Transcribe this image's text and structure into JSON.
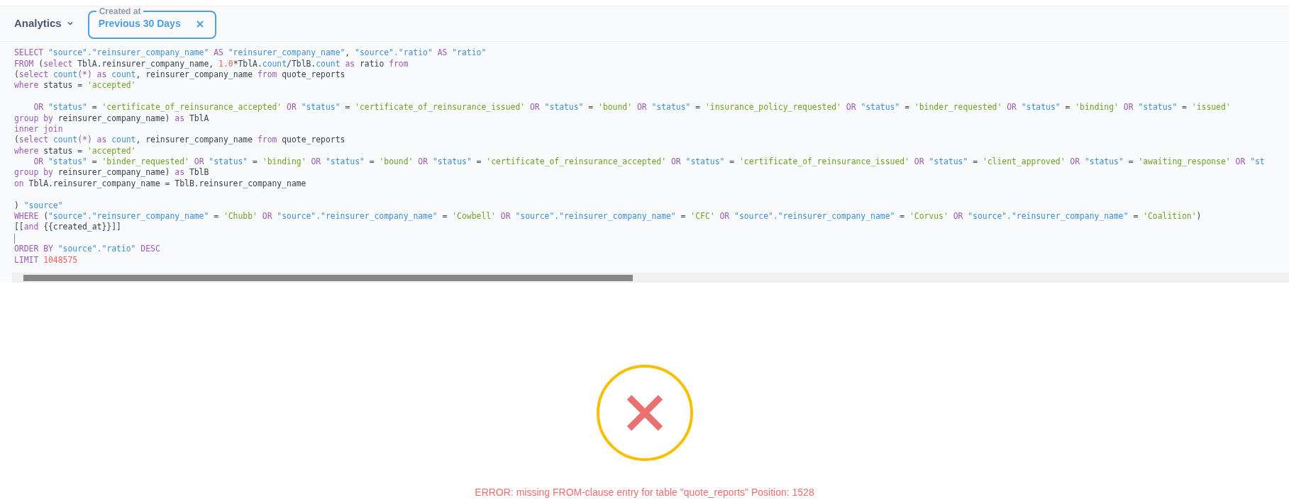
{
  "header": {
    "title": "Analytics",
    "filter": {
      "label": "Created at",
      "value": "Previous 30 Days"
    }
  },
  "editor": {
    "lines": [
      {
        "kind": "code",
        "tokens": [
          {
            "kind": "k",
            "text": "SELECT "
          },
          {
            "kind": "i",
            "text": "\"source\".\"reinsurer_company_name\""
          },
          {
            "kind": "k",
            "text": " AS "
          },
          {
            "kind": "i",
            "text": "\"reinsurer_company_name\""
          },
          {
            "kind": "p",
            "text": ", "
          },
          {
            "kind": "i",
            "text": "\"source\".\"ratio\""
          },
          {
            "kind": "k",
            "text": " AS "
          },
          {
            "kind": "i",
            "text": "\"ratio\""
          }
        ]
      },
      {
        "kind": "code",
        "tokens": [
          {
            "kind": "k",
            "text": "FROM"
          },
          {
            "kind": "p",
            "text": " ("
          },
          {
            "kind": "k",
            "text": "select"
          },
          {
            "kind": "p",
            "text": " TblA.reinsurer_company_name, "
          },
          {
            "kind": "n",
            "text": "1.0"
          },
          {
            "kind": "p",
            "text": "*TblA."
          },
          {
            "kind": "i",
            "text": "count"
          },
          {
            "kind": "p",
            "text": "/TblB."
          },
          {
            "kind": "i",
            "text": "count"
          },
          {
            "kind": "k",
            "text": " as"
          },
          {
            "kind": "p",
            "text": " ratio "
          },
          {
            "kind": "k",
            "text": "from"
          }
        ]
      },
      {
        "kind": "code",
        "tokens": [
          {
            "kind": "p",
            "text": "("
          },
          {
            "kind": "k",
            "text": "select "
          },
          {
            "kind": "i",
            "text": "count"
          },
          {
            "kind": "k",
            "text": "(*) as "
          },
          {
            "kind": "i",
            "text": "count"
          },
          {
            "kind": "p",
            "text": ", reinsurer_company_name "
          },
          {
            "kind": "k",
            "text": "from"
          },
          {
            "kind": "p",
            "text": " quote_reports"
          }
        ]
      },
      {
        "kind": "code",
        "tokens": [
          {
            "kind": "k",
            "text": "where"
          },
          {
            "kind": "p",
            "text": " status = "
          },
          {
            "kind": "s",
            "text": "'accepted'"
          }
        ]
      },
      {
        "kind": "blank"
      },
      {
        "kind": "code",
        "tokens": [
          {
            "kind": "k",
            "text": "    OR "
          },
          {
            "kind": "i",
            "text": "\"status\""
          },
          {
            "kind": "p",
            "text": " = "
          },
          {
            "kind": "s",
            "text": "'certificate_of_reinsurance_accepted'"
          },
          {
            "kind": "k",
            "text": " OR "
          },
          {
            "kind": "i",
            "text": "\"status\""
          },
          {
            "kind": "p",
            "text": " = "
          },
          {
            "kind": "s",
            "text": "'certificate_of_reinsurance_issued'"
          },
          {
            "kind": "k",
            "text": " OR "
          },
          {
            "kind": "i",
            "text": "\"status\""
          },
          {
            "kind": "p",
            "text": " = "
          },
          {
            "kind": "s",
            "text": "'bound'"
          },
          {
            "kind": "k",
            "text": " OR "
          },
          {
            "kind": "i",
            "text": "\"status\""
          },
          {
            "kind": "p",
            "text": " = "
          },
          {
            "kind": "s",
            "text": "'insurance_policy_requested'"
          },
          {
            "kind": "k",
            "text": " OR "
          },
          {
            "kind": "i",
            "text": "\"status\""
          },
          {
            "kind": "p",
            "text": " = "
          },
          {
            "kind": "s",
            "text": "'binder_requested'"
          },
          {
            "kind": "k",
            "text": " OR "
          },
          {
            "kind": "i",
            "text": "\"status\""
          },
          {
            "kind": "p",
            "text": " = "
          },
          {
            "kind": "s",
            "text": "'binding'"
          },
          {
            "kind": "k",
            "text": " OR "
          },
          {
            "kind": "i",
            "text": "\"status\""
          },
          {
            "kind": "p",
            "text": " = "
          },
          {
            "kind": "s",
            "text": "'issued'"
          }
        ]
      },
      {
        "kind": "code",
        "tokens": [
          {
            "kind": "k",
            "text": "group by"
          },
          {
            "kind": "p",
            "text": " reinsurer_company_name) "
          },
          {
            "kind": "k",
            "text": "as"
          },
          {
            "kind": "p",
            "text": " TblA"
          }
        ]
      },
      {
        "kind": "code",
        "tokens": [
          {
            "kind": "k",
            "text": "inner join"
          }
        ]
      },
      {
        "kind": "code",
        "tokens": [
          {
            "kind": "p",
            "text": "("
          },
          {
            "kind": "k",
            "text": "select "
          },
          {
            "kind": "i",
            "text": "count"
          },
          {
            "kind": "k",
            "text": "(*) as "
          },
          {
            "kind": "i",
            "text": "count"
          },
          {
            "kind": "p",
            "text": ", reinsurer_company_name "
          },
          {
            "kind": "k",
            "text": "from"
          },
          {
            "kind": "p",
            "text": " quote_reports"
          }
        ]
      },
      {
        "kind": "code",
        "tokens": [
          {
            "kind": "k",
            "text": "where"
          },
          {
            "kind": "p",
            "text": " status = "
          },
          {
            "kind": "s",
            "text": "'accepted'"
          }
        ]
      },
      {
        "kind": "code",
        "tokens": [
          {
            "kind": "k",
            "text": "    OR "
          },
          {
            "kind": "i",
            "text": "\"status\""
          },
          {
            "kind": "p",
            "text": " = "
          },
          {
            "kind": "s",
            "text": "'binder_requested'"
          },
          {
            "kind": "k",
            "text": " OR "
          },
          {
            "kind": "i",
            "text": "\"status\""
          },
          {
            "kind": "p",
            "text": " = "
          },
          {
            "kind": "s",
            "text": "'binding'"
          },
          {
            "kind": "k",
            "text": " OR "
          },
          {
            "kind": "i",
            "text": "\"status\""
          },
          {
            "kind": "p",
            "text": " = "
          },
          {
            "kind": "s",
            "text": "'bound'"
          },
          {
            "kind": "k",
            "text": " OR "
          },
          {
            "kind": "i",
            "text": "\"status\""
          },
          {
            "kind": "p",
            "text": " = "
          },
          {
            "kind": "s",
            "text": "'certificate_of_reinsurance_accepted'"
          },
          {
            "kind": "k",
            "text": " OR "
          },
          {
            "kind": "i",
            "text": "\"status\""
          },
          {
            "kind": "p",
            "text": " = "
          },
          {
            "kind": "s",
            "text": "'certificate_of_reinsurance_issued'"
          },
          {
            "kind": "k",
            "text": " OR "
          },
          {
            "kind": "i",
            "text": "\"status\""
          },
          {
            "kind": "p",
            "text": " = "
          },
          {
            "kind": "s",
            "text": "'client_approved'"
          },
          {
            "kind": "k",
            "text": " OR "
          },
          {
            "kind": "i",
            "text": "\"status\""
          },
          {
            "kind": "p",
            "text": " = "
          },
          {
            "kind": "s",
            "text": "'awaiting_response'"
          },
          {
            "kind": "k",
            "text": " OR "
          },
          {
            "kind": "i",
            "text": "\"st"
          }
        ]
      },
      {
        "kind": "code",
        "tokens": [
          {
            "kind": "k",
            "text": "group by"
          },
          {
            "kind": "p",
            "text": " reinsurer_company_name) "
          },
          {
            "kind": "k",
            "text": "as"
          },
          {
            "kind": "p",
            "text": " TblB"
          }
        ]
      },
      {
        "kind": "code",
        "tokens": [
          {
            "kind": "k",
            "text": "on"
          },
          {
            "kind": "p",
            "text": " TblA.reinsurer_company_name = TblB.reinsurer_company_name"
          }
        ]
      },
      {
        "kind": "blank"
      },
      {
        "kind": "code",
        "tokens": [
          {
            "kind": "p",
            "text": ") "
          },
          {
            "kind": "i",
            "text": "\"source\""
          }
        ]
      },
      {
        "kind": "code",
        "tokens": [
          {
            "kind": "k",
            "text": "WHERE"
          },
          {
            "kind": "p",
            "text": " ("
          },
          {
            "kind": "i",
            "text": "\"source\".\"reinsurer_company_name\""
          },
          {
            "kind": "p",
            "text": " = "
          },
          {
            "kind": "s",
            "text": "'Chubb'"
          },
          {
            "kind": "k",
            "text": " OR "
          },
          {
            "kind": "i",
            "text": "\"source\".\"reinsurer_company_name\""
          },
          {
            "kind": "p",
            "text": " = "
          },
          {
            "kind": "s",
            "text": "'Cowbell'"
          },
          {
            "kind": "k",
            "text": " OR "
          },
          {
            "kind": "i",
            "text": "\"source\".\"reinsurer_company_name\""
          },
          {
            "kind": "p",
            "text": " = "
          },
          {
            "kind": "s",
            "text": "'CFC'"
          },
          {
            "kind": "k",
            "text": " OR "
          },
          {
            "kind": "i",
            "text": "\"source\".\"reinsurer_company_name\""
          },
          {
            "kind": "p",
            "text": " = "
          },
          {
            "kind": "s",
            "text": "'Corvus'"
          },
          {
            "kind": "k",
            "text": " OR "
          },
          {
            "kind": "i",
            "text": "\"source\".\"reinsurer_company_name\""
          },
          {
            "kind": "p",
            "text": " = "
          },
          {
            "kind": "s",
            "text": "'Coalition'"
          },
          {
            "kind": "p",
            "text": ")"
          }
        ]
      },
      {
        "kind": "code",
        "tokens": [
          {
            "kind": "p",
            "text": "[["
          },
          {
            "kind": "k",
            "text": "and"
          },
          {
            "kind": "p",
            "text": " {{created_at}}]]"
          }
        ]
      },
      {
        "kind": "blank",
        "cursor": true
      },
      {
        "kind": "code",
        "tokens": [
          {
            "kind": "k",
            "text": "ORDER BY "
          },
          {
            "kind": "i",
            "text": "\"source\".\"ratio\""
          },
          {
            "kind": "k",
            "text": " DESC"
          }
        ]
      },
      {
        "kind": "code",
        "tokens": [
          {
            "kind": "k",
            "text": "LIMIT "
          },
          {
            "kind": "n",
            "text": "1048575"
          }
        ]
      }
    ]
  },
  "error": {
    "message": "ERROR: missing FROM-clause entry for table \"quote_reports\" Position: 1528"
  }
}
